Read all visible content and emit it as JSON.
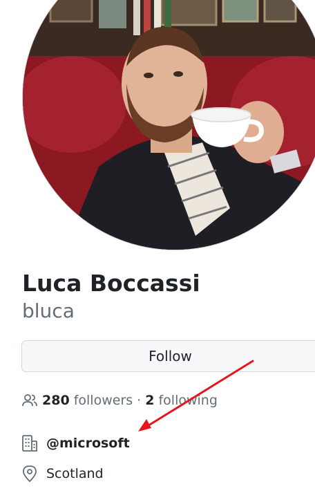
{
  "profile": {
    "full_name": "Luca Boccassi",
    "username": "bluca",
    "follow_label": "Follow",
    "followers_count": "280",
    "followers_label": "followers",
    "separator": "·",
    "following_count": "2",
    "following_label": "following",
    "organization": "@microsoft",
    "location": "Scotland"
  },
  "icons": {
    "people": "people-icon",
    "organization": "organization-icon",
    "location": "location-icon"
  },
  "colors": {
    "annotation_arrow": "#e8141c",
    "muted_text": "#636c76",
    "primary_text": "#1f2328",
    "button_bg": "#f6f8fa",
    "border": "#d0d7de"
  }
}
